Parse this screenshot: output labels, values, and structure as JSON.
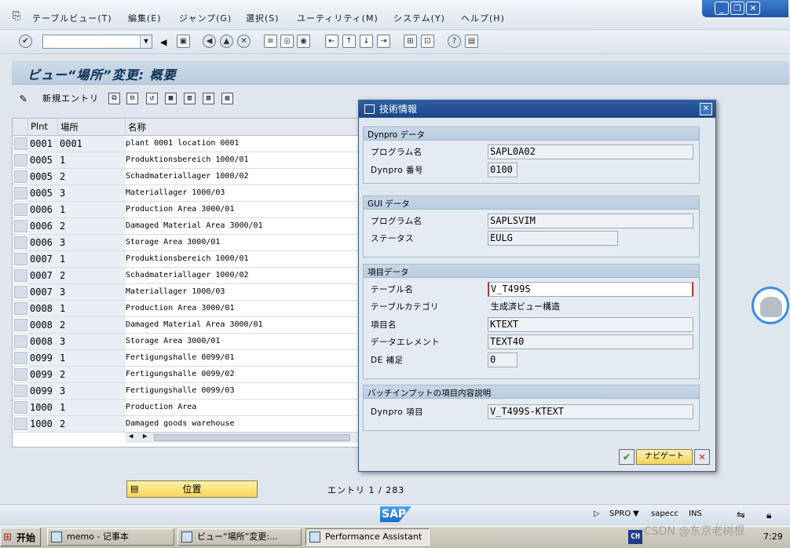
{
  "menu": {
    "items": [
      "テーブルビュー(T)",
      "編集(E)",
      "ジャンプ(G)",
      "選択(S)",
      "ユーティリティ(M)",
      "システム(Y)",
      "ヘルプ(H)"
    ]
  },
  "window_controls": {
    "minimize": "_",
    "restore": "❐",
    "close": "✕"
  },
  "toolbar": {
    "icons": [
      "enter-icon",
      "back-icon",
      "exit-icon",
      "cancel-icon",
      "print-icon",
      "find-icon",
      "find-next-icon",
      "first-page-icon",
      "prev-page-icon",
      "next-page-icon",
      "last-page-icon",
      "new-session-icon",
      "shortcut-icon",
      "help-icon",
      "layout-icon"
    ]
  },
  "page_title": "ビュー“場所”変更: 概要",
  "app_toolbar": {
    "new_entries": "新規エントリ"
  },
  "table": {
    "headers": {
      "plant": "Plnt",
      "location": "場所",
      "name": "名称"
    },
    "rows": [
      {
        "plant": "0001",
        "location": "0001",
        "name": "plant 0001 location 0001"
      },
      {
        "plant": "0005",
        "location": "1",
        "name": "Produktionsbereich 1000/01"
      },
      {
        "plant": "0005",
        "location": "2",
        "name": "Schadmateriallager 1000/02"
      },
      {
        "plant": "0005",
        "location": "3",
        "name": "Materiallager 1000/03"
      },
      {
        "plant": "0006",
        "location": "1",
        "name": "Production Area 3000/01"
      },
      {
        "plant": "0006",
        "location": "2",
        "name": "Damaged Material Area 3000/01"
      },
      {
        "plant": "0006",
        "location": "3",
        "name": "Storage Area  3000/01"
      },
      {
        "plant": "0007",
        "location": "1",
        "name": "Produktionsbereich 1000/01"
      },
      {
        "plant": "0007",
        "location": "2",
        "name": "Schadmateriallager 1000/02"
      },
      {
        "plant": "0007",
        "location": "3",
        "name": "Materiallager 1000/03"
      },
      {
        "plant": "0008",
        "location": "1",
        "name": "Production Area 3000/01"
      },
      {
        "plant": "0008",
        "location": "2",
        "name": "Damaged Material Area 3000/01"
      },
      {
        "plant": "0008",
        "location": "3",
        "name": "Storage Area  3000/01"
      },
      {
        "plant": "0099",
        "location": "1",
        "name": "Fertigungshalle 0099/01"
      },
      {
        "plant": "0099",
        "location": "2",
        "name": "Fertigungshalle 0099/02"
      },
      {
        "plant": "0099",
        "location": "3",
        "name": "Fertigungshalle 0099/03"
      },
      {
        "plant": "1000",
        "location": "1",
        "name": "Production Area"
      },
      {
        "plant": "1000",
        "location": "2",
        "name": "Damaged goods warehouse"
      }
    ]
  },
  "position_button": "位置",
  "entry_count": "エントリ 1 / 283",
  "status": {
    "tx": "SPRO",
    "server": "sapecc",
    "mode": "INS",
    "logo": "SAP"
  },
  "dialog": {
    "title": "技術情報",
    "dynpro_group": {
      "header": "Dynpro データ",
      "program_label": "プログラム名",
      "program_value": "SAPL0A02",
      "number_label": "Dynpro 番号",
      "number_value": "0100"
    },
    "gui_group": {
      "header": "GUI データ",
      "program_label": "プログラム名",
      "program_value": "SAPLSVIM",
      "status_label": "ステータス",
      "status_value": "EULG"
    },
    "field_group": {
      "header": "項目データ",
      "table_label": "テーブル名",
      "table_value": "V_T499S",
      "category_label": "テーブルカテゴリ",
      "category_value": "生成済ビュー構造",
      "field_label": "項目名",
      "field_value": "KTEXT",
      "element_label": "データエレメント",
      "element_value": "TEXT40",
      "de_label": "DE 補足",
      "de_value": "0"
    },
    "batch_group": {
      "header": "バッチインプットの項目内容説明",
      "item_label": "Dynpro 項目",
      "item_value": "V_T499S-KTEXT"
    },
    "navigate_button": "ナビゲート"
  },
  "taskbar": {
    "start": "开始",
    "tasks": [
      "memo - 记事本",
      "ビュー“場所”変更:...",
      "Performance Assistant"
    ],
    "ime": "CH",
    "clock": "7:29"
  },
  "watermark": "CSDN @东京老树根"
}
